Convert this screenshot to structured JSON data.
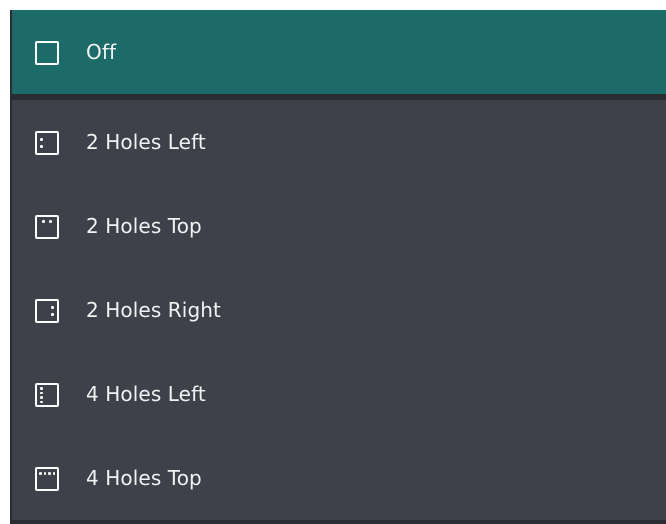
{
  "hole_punch": {
    "options": [
      {
        "label": "Off",
        "icon": "no-hole-icon",
        "selected": true
      },
      {
        "label": "2 Holes Left",
        "icon": "two-holes-left-icon",
        "selected": false
      },
      {
        "label": "2 Holes Top",
        "icon": "two-holes-top-icon",
        "selected": false
      },
      {
        "label": "2 Holes Right",
        "icon": "two-holes-right-icon",
        "selected": false
      },
      {
        "label": "4 Holes Left",
        "icon": "four-holes-left-icon",
        "selected": false
      },
      {
        "label": "4 Holes Top",
        "icon": "four-holes-top-icon",
        "selected": false
      }
    ]
  },
  "colors": {
    "selected_bg": "#1d6b68",
    "item_bg": "#3f414a",
    "divider": "#2b2d33",
    "text": "#f2f2f2"
  }
}
